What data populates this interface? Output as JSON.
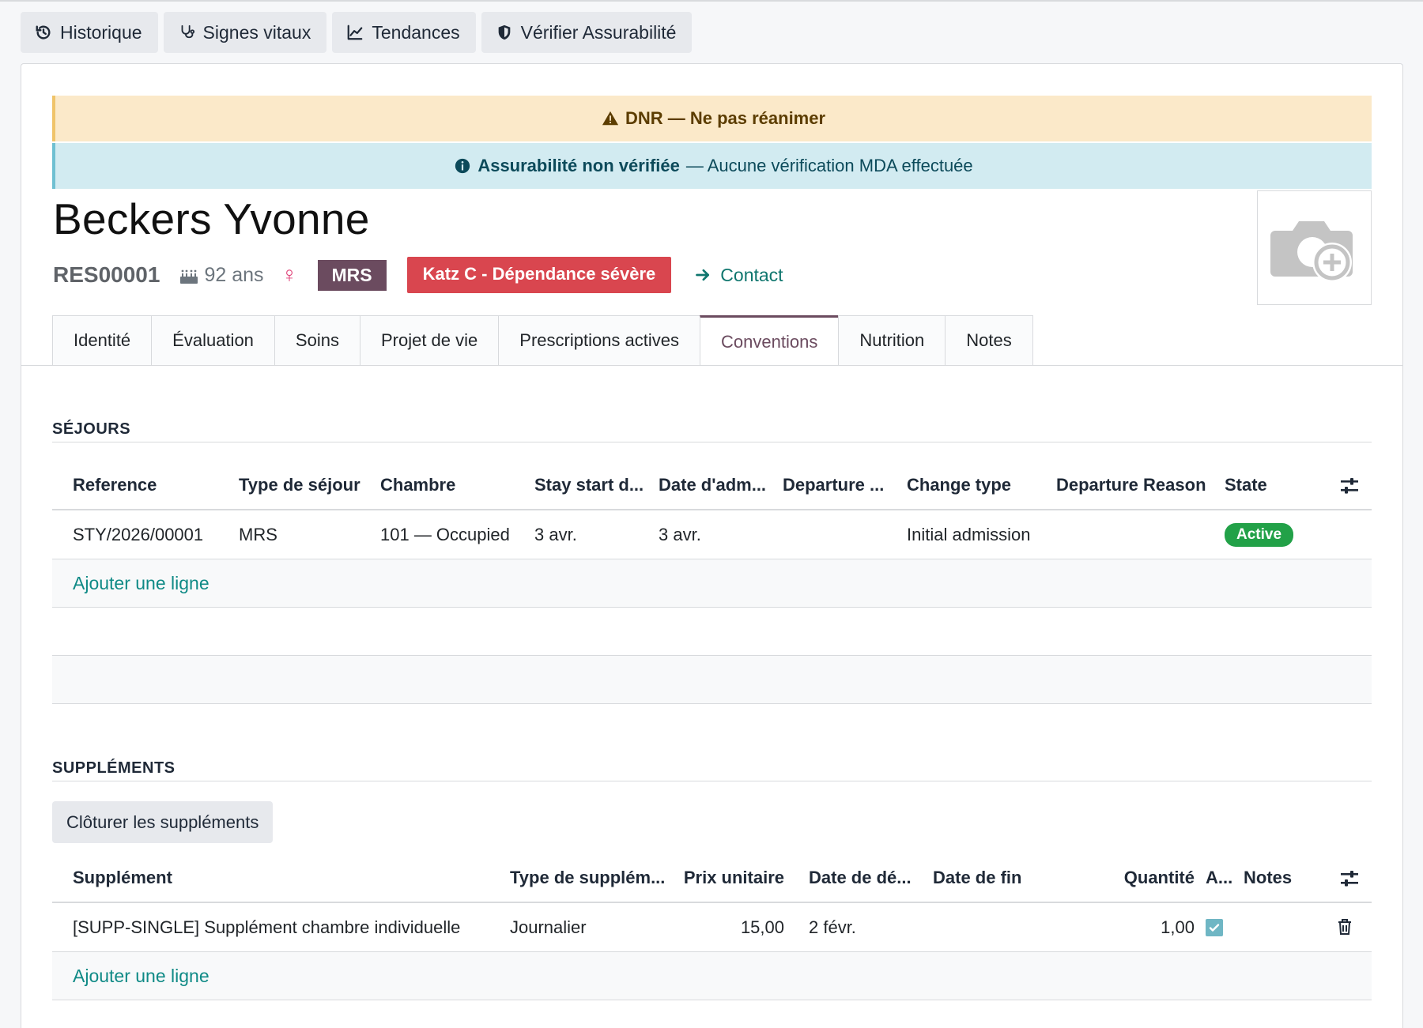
{
  "actions": [
    {
      "label": "Historique",
      "icon": "history-icon"
    },
    {
      "label": "Signes vitaux",
      "icon": "stethoscope-icon"
    },
    {
      "label": "Tendances",
      "icon": "line-chart-icon"
    },
    {
      "label": "Vérifier Assurabilité",
      "icon": "shield-icon"
    }
  ],
  "alerts": {
    "dnr": "DNR — Ne pas réanimer",
    "insurance_bold": "Assurabilité non vérifiée",
    "insurance_rest": "— Aucune vérification MDA effectuée"
  },
  "resident": {
    "name": "Beckers Yvonne",
    "reference": "RES00001",
    "age": "92 ans",
    "gender_symbol": "♀",
    "stay_type_badge": "MRS",
    "katz_badge": "Katz C - Dépendance sévère",
    "contact_label": "Contact"
  },
  "tabs": [
    {
      "label": "Identité",
      "active": false
    },
    {
      "label": "Évaluation",
      "active": false
    },
    {
      "label": "Soins",
      "active": false
    },
    {
      "label": "Projet de vie",
      "active": false
    },
    {
      "label": "Prescriptions actives",
      "active": false
    },
    {
      "label": "Conventions",
      "active": true
    },
    {
      "label": "Nutrition",
      "active": false
    },
    {
      "label": "Notes",
      "active": false
    }
  ],
  "sejours": {
    "title": "SÉJOURS",
    "columns": [
      "Reference",
      "Type de séjour",
      "Chambre",
      "Stay start d...",
      "Date d'adm...",
      "Departure ...",
      "Change type",
      "Departure Reason",
      "State"
    ],
    "rows": [
      {
        "reference": "STY/2026/00001",
        "type": "MRS",
        "chambre": "101 — Occupied",
        "stay_start": "3 avr.",
        "date_adm": "3 avr.",
        "departure": "",
        "change_type": "Initial admission",
        "departure_reason": "",
        "state": "Active"
      }
    ],
    "add_line": "Ajouter une ligne"
  },
  "supplements": {
    "title": "SUPPLÉMENTS",
    "close_button": "Clôturer les suppléments",
    "columns": [
      "Supplément",
      "Type de supplém...",
      "Prix unitaire",
      "Date de dé...",
      "Date de fin",
      "Quantité",
      "A...",
      "Notes"
    ],
    "rows": [
      {
        "supplement": "[SUPP-SINGLE] Supplément chambre individuelle",
        "type": "Journalier",
        "prix": "15,00",
        "date_debut": "2 févr.",
        "date_fin": "",
        "quantite": "1,00",
        "active": true,
        "notes": ""
      }
    ],
    "add_line": "Ajouter une ligne"
  },
  "colors": {
    "accent": "#6b4b5f",
    "link": "#0f8a86",
    "danger": "#d9464f",
    "success": "#22a148"
  }
}
